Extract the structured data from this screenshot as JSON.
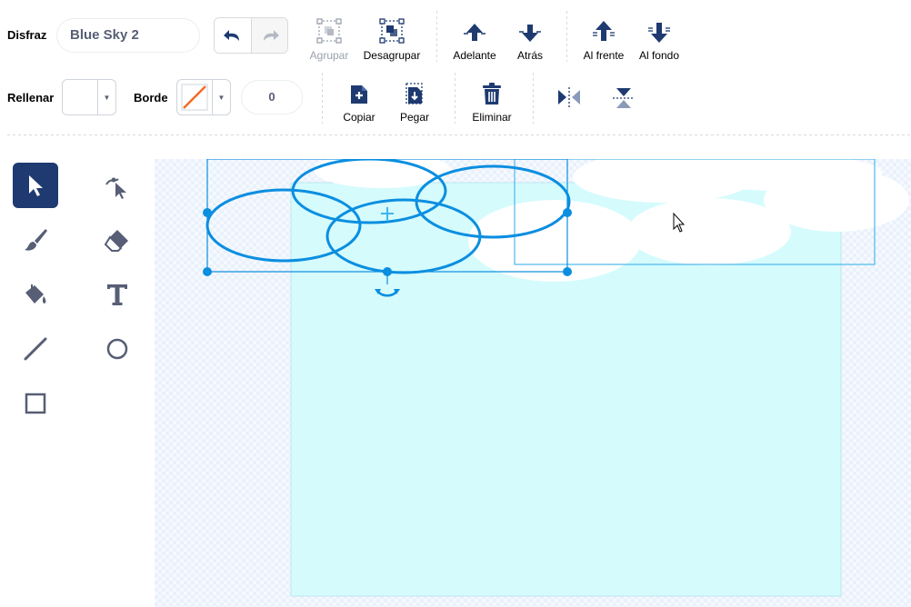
{
  "costume": {
    "label": "Disfraz",
    "name_value": "Blue Sky 2"
  },
  "toolbar": {
    "group_label": "Agrupar",
    "ungroup_label": "Desagrupar",
    "forward_label": "Adelante",
    "backward_label": "Atrás",
    "front_label": "Al frente",
    "back_label": "Al fondo",
    "copy_label": "Copiar",
    "paste_label": "Pegar",
    "delete_label": "Eliminar"
  },
  "fill": {
    "label": "Rellenar",
    "color": "#ffffff"
  },
  "outline": {
    "label": "Borde",
    "width_value": "0"
  },
  "colors": {
    "accent": "#855cd6",
    "selected_tool": "#1e3a70",
    "selection": "#0b8ee0",
    "icon": "#575e75",
    "sky": "#d5fbfd"
  }
}
